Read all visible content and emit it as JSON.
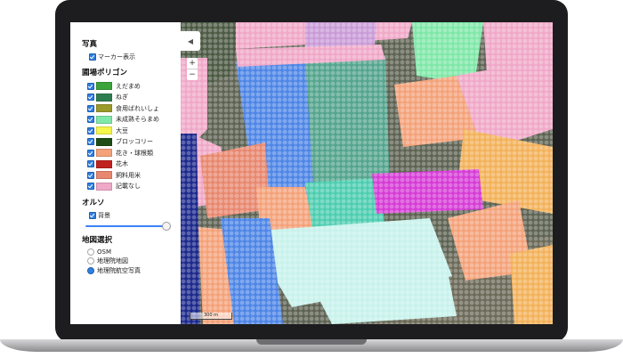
{
  "sidebar": {
    "photo_title": "写真",
    "marker_label": "マーカー表示",
    "polygon_title": "圃場ポリゴン",
    "crops": [
      {
        "label": "えだまめ",
        "color": "#3aa33a"
      },
      {
        "label": "ねぎ",
        "color": "#2e7d50"
      },
      {
        "label": "食用ばれいしょ",
        "color": "#9a9a2a"
      },
      {
        "label": "未成熟そらまめ",
        "color": "#7fe8a8"
      },
      {
        "label": "大豆",
        "color": "#f5f54a"
      },
      {
        "label": "ブロッコリー",
        "color": "#1e4d14"
      },
      {
        "label": "花き・球根類",
        "color": "#f4a27a"
      },
      {
        "label": "花木",
        "color": "#c0231f"
      },
      {
        "label": "飼料用米",
        "color": "#e88870"
      },
      {
        "label": "記載なし",
        "color": "#f0a8c8"
      }
    ],
    "ortho_title": "オルソ",
    "background_label": "背景",
    "background_opacity": 1.0,
    "map_select_title": "地図選択",
    "map_options": [
      "OSM",
      "地理院地図",
      "地理院航空写真"
    ],
    "selected_map": "地理院航空写真"
  },
  "map": {
    "collapse_glyph": "◀",
    "zoom_in": "+",
    "zoom_out": "−",
    "scale_label": "300 m"
  }
}
